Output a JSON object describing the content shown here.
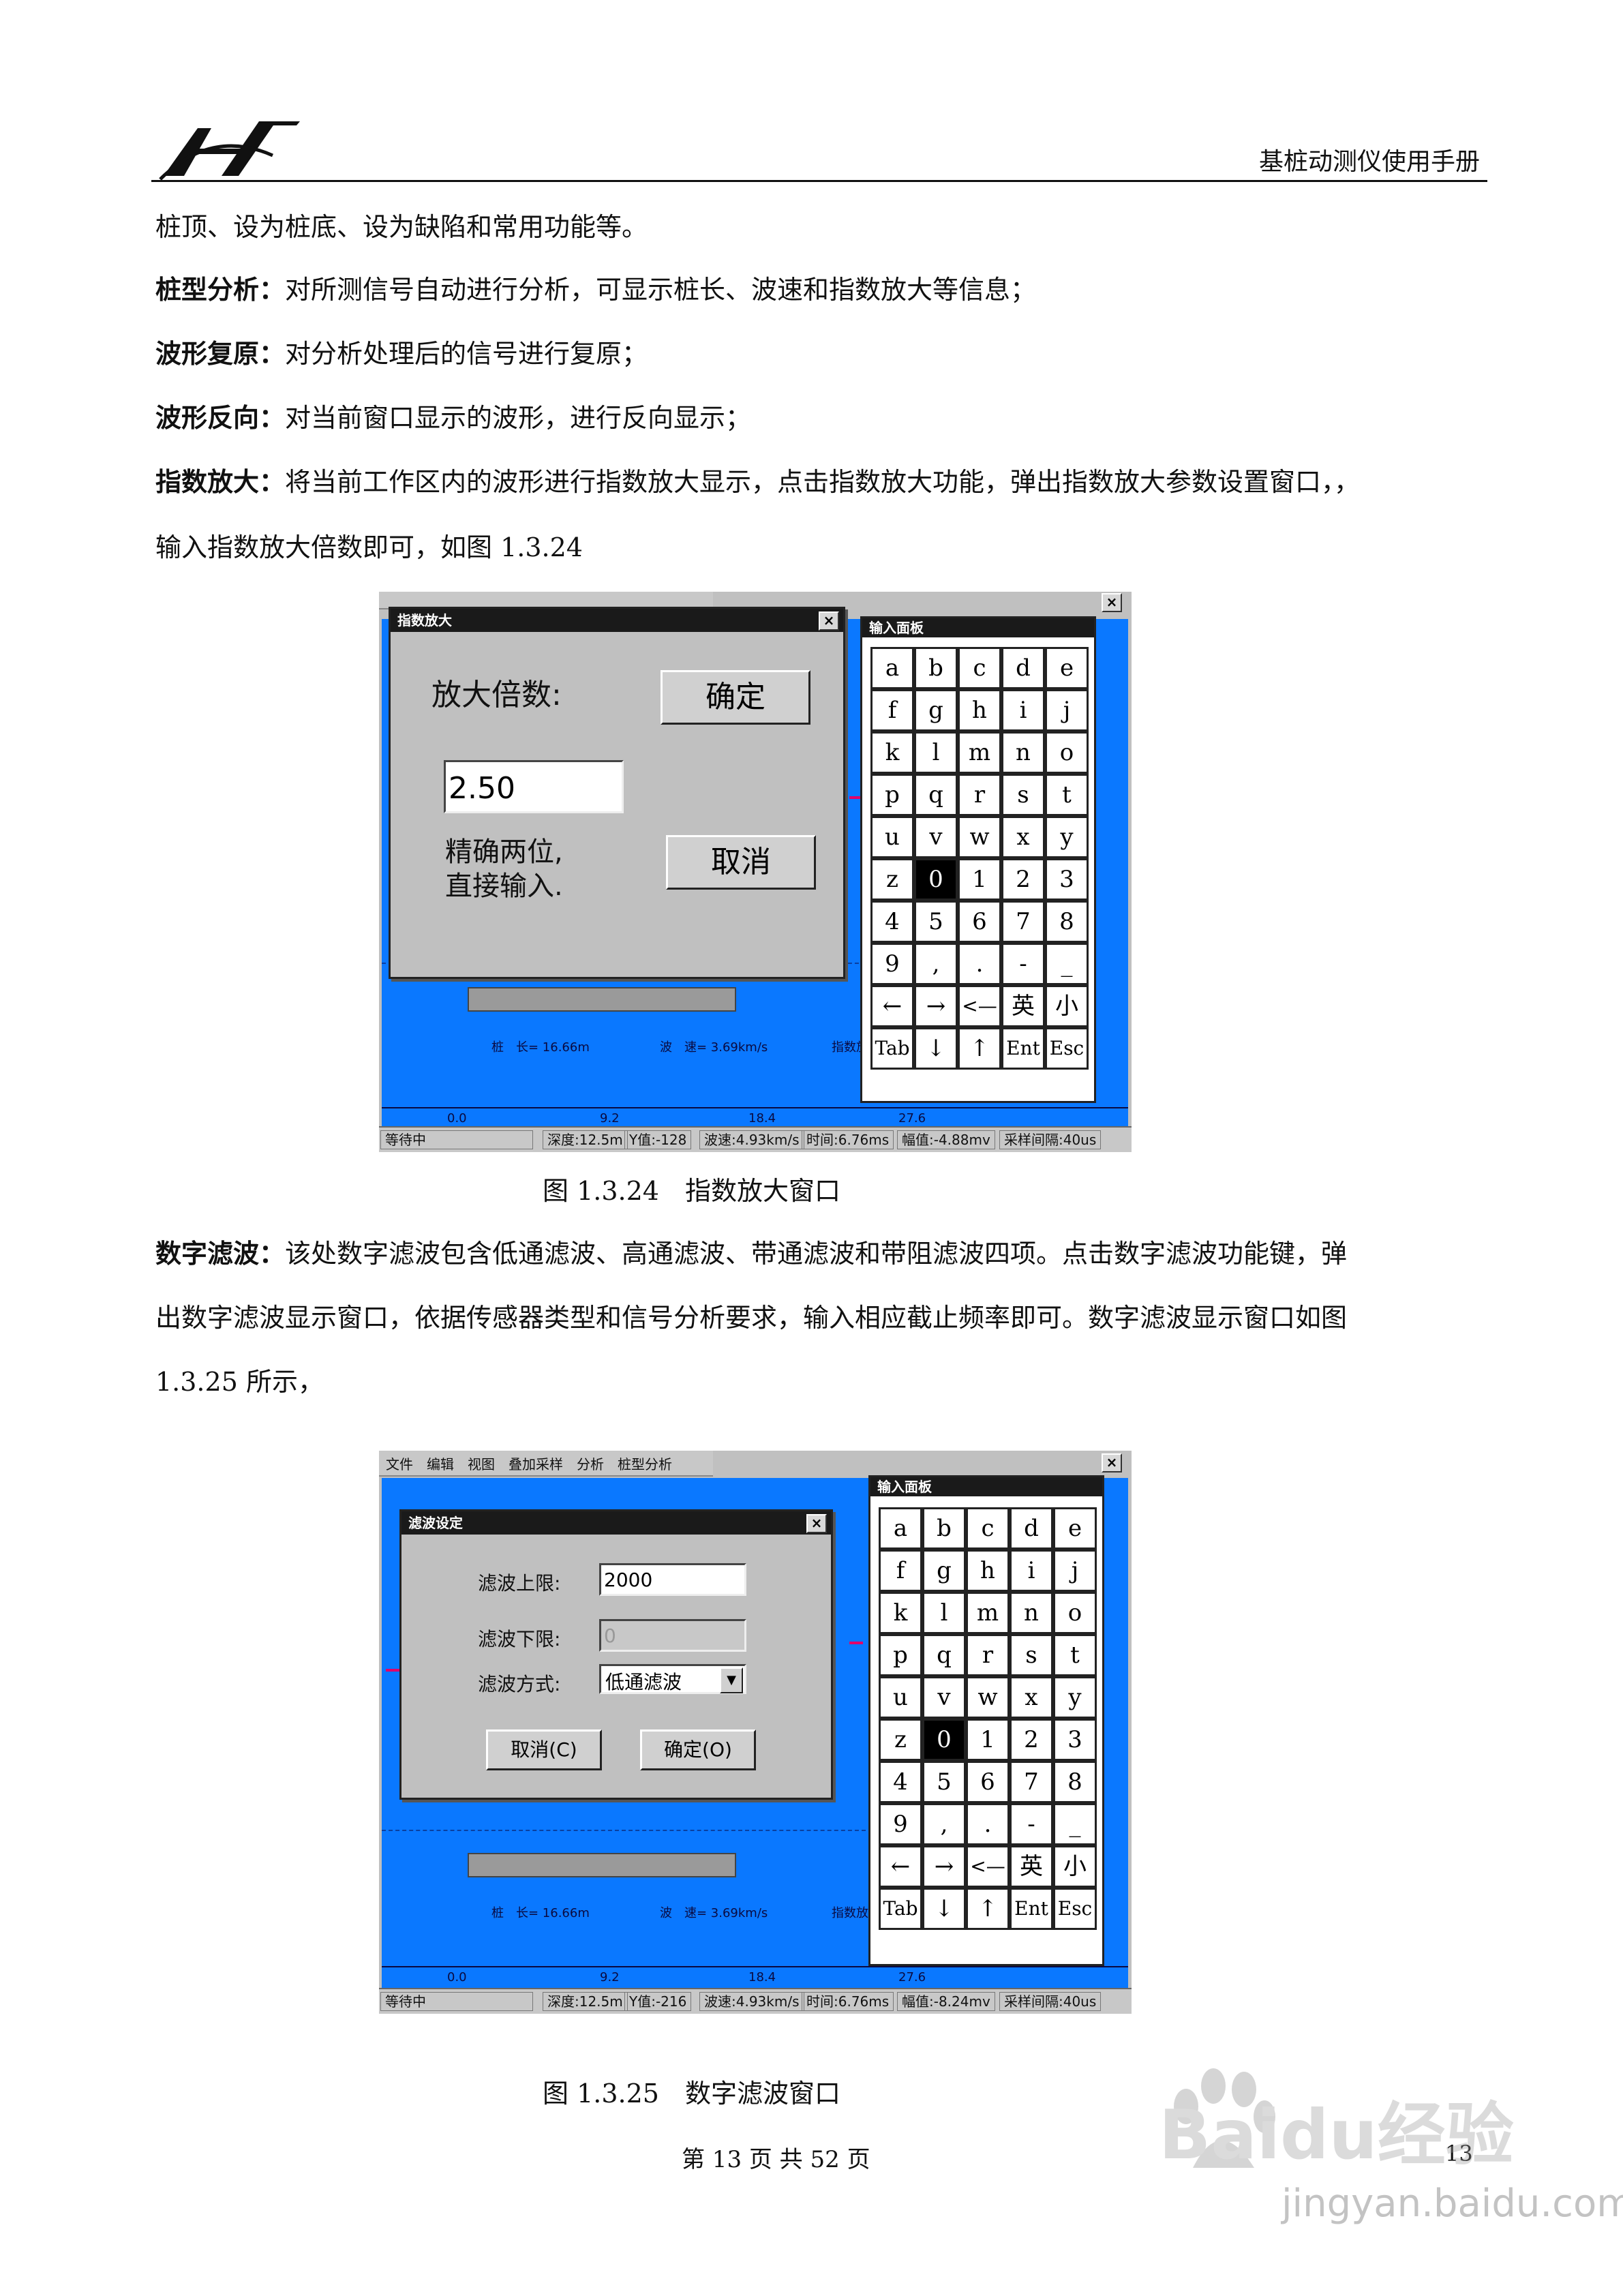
{
  "header": {
    "logo_text": "YH",
    "title": "基桩动测仪使用手册"
  },
  "paragraphs": [
    {
      "text": "桩顶、设为桩底、设为缺陷和常用功能等。"
    },
    {
      "term": "桩型分析：",
      "text": "对所测信号自动进行分析，可显示桩长、波速和指数放大等信息；"
    },
    {
      "term": "波形复原：",
      "text": "对分析处理后的信号进行复原；"
    },
    {
      "term": "波形反向：",
      "text": "对当前窗口显示的波形，进行反向显示；"
    },
    {
      "term": "指数放大：",
      "text": "将当前工作区内的波形进行指数放大显示，点击指数放大功能，弹出指数放大参数设置窗口，，"
    },
    {
      "text": "输入指数放大倍数即可，如图 1.3.24"
    }
  ],
  "figure1": {
    "caption": "图 1.3.24　指数放大窗口",
    "dialog_title": "指数放大",
    "close": "×",
    "label": "放大倍数:",
    "ok": "确定",
    "value": "2.50",
    "hint1": "精确两位,",
    "hint2": "直接输入.",
    "cancel": "取消",
    "info": {
      "pile_len": "桩　长= 16.66m",
      "wave_speed": "波　速= 3.69km/s",
      "exp": "指数放"
    },
    "axis": [
      "0.0",
      "9.2",
      "18.4",
      "27.6"
    ],
    "status": {
      "s0": "等待中",
      "s1": "深度:12.5m",
      "s2": "Y值:-128",
      "s3": "波速:4.93km/s",
      "s4": "时间:6.76ms",
      "s5": "幅值:-4.88mv",
      "s6": "采样间隔:40us"
    }
  },
  "para2": {
    "term": "数字滤波：",
    "line1": "该处数字滤波包含低通滤波、高通滤波、带通滤波和带阻滤波四项。点击数字滤波功能键，弹",
    "line2": "出数字滤波显示窗口，依据传感器类型和信号分析要求，输入相应截止频率即可。数字滤波显示窗口如图",
    "line3": "1.3.25 所示，"
  },
  "figure2": {
    "caption": "图 1.3.25　数字滤波窗口",
    "menu": [
      "文件",
      "编辑",
      "视图",
      "叠加采样",
      "分析",
      "桩型分析"
    ],
    "close": "×",
    "dialog_title": "滤波设定",
    "upper_label": "滤波上限:",
    "upper_value": "2000",
    "lower_label": "滤波下限:",
    "lower_value": "0",
    "mode_label": "滤波方式:",
    "mode_value": "低通滤波",
    "cancel": "取消(C)",
    "ok": "确定(O)",
    "info": {
      "pile_len": "桩　长= 16.66m",
      "wave_speed": "波　速= 3.69km/s",
      "exp": "指数放"
    },
    "axis": [
      "0.0",
      "9.2",
      "18.4",
      "27.6"
    ],
    "status": {
      "s0": "等待中",
      "s1": "深度:12.5m",
      "s2": "Y值:-216",
      "s3": "波速:4.93km/s",
      "s4": "时间:6.76ms",
      "s5": "幅值:-8.24mv",
      "s6": "采样间隔:40us"
    }
  },
  "keypad": {
    "title": "输入面板",
    "keys": [
      [
        "a",
        "b",
        "c",
        "d",
        "e"
      ],
      [
        "f",
        "g",
        "h",
        "i",
        "j"
      ],
      [
        "k",
        "l",
        "m",
        "n",
        "o"
      ],
      [
        "p",
        "q",
        "r",
        "s",
        "t"
      ],
      [
        "u",
        "v",
        "w",
        "x",
        "y"
      ],
      [
        "z",
        "0",
        "1",
        "2",
        "3"
      ],
      [
        "4",
        "5",
        "6",
        "7",
        "8"
      ],
      [
        "9",
        ",",
        ".",
        "-",
        "_"
      ],
      [
        "←",
        "→",
        "<—",
        "英",
        "小"
      ],
      [
        "Tab",
        "↓",
        "↑",
        "Ent",
        "Esc"
      ]
    ]
  },
  "footer": {
    "page_text": "第 13 页 共 52 页",
    "page_num": "13"
  },
  "watermark": {
    "brand": "Baidu经验",
    "url": "jingyan.baidu.com"
  }
}
